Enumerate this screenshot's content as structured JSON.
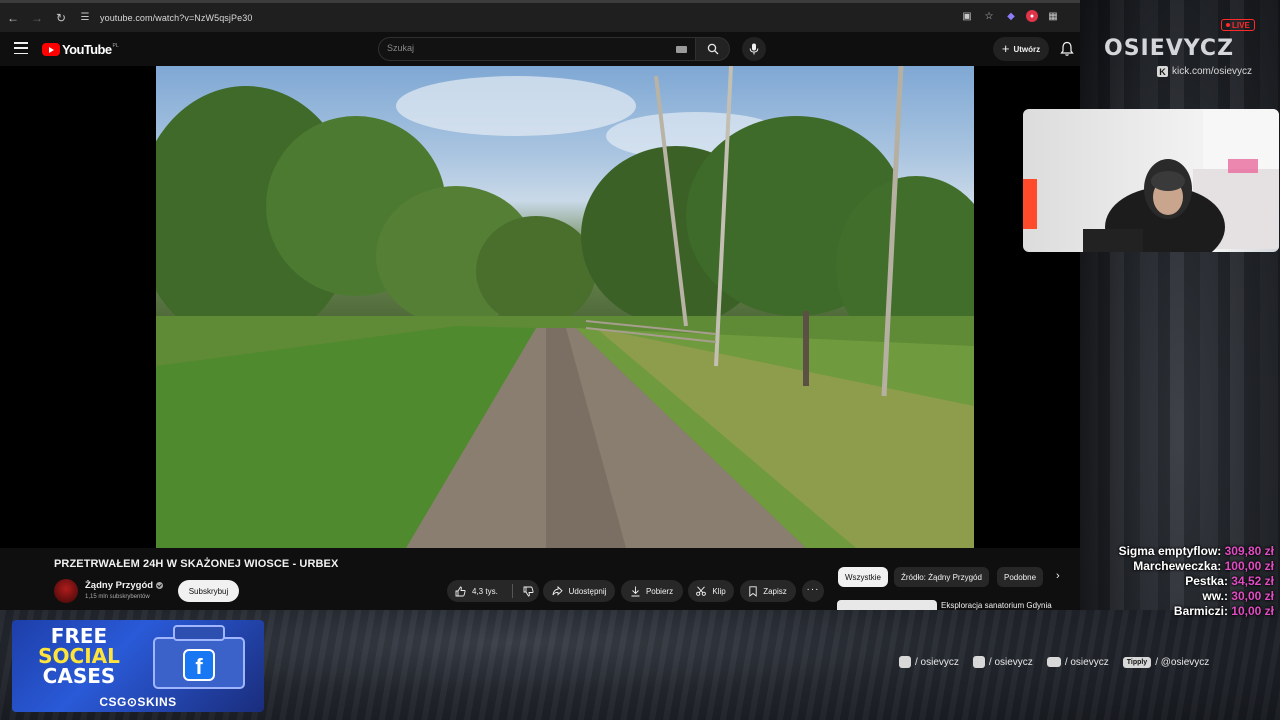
{
  "browser": {
    "url": "youtube.com/watch?v=NzW5qsjPe30"
  },
  "youtube": {
    "logo_text": "YouTube",
    "region": "PL",
    "search_placeholder": "Szukaj",
    "create_label": "Utwórz"
  },
  "video": {
    "title": "PRZETRWAŁEM 24H W SKAŻONEJ WIOSCE - URBEX",
    "channel": "Żądny Przygód",
    "subscribers": "1,15 mln subskrybentów",
    "subscribe_label": "Subskrybuj",
    "likes": "4,3 tys.",
    "share_label": "Udostępnij",
    "download_label": "Pobierz",
    "clip_label": "Klip",
    "save_label": "Zapisz"
  },
  "related": {
    "chips": [
      "Wszystkie",
      "Źródło: Żądny Przygód",
      "Podobne"
    ],
    "first_title": "Eksploracja sanatorium Gdynia"
  },
  "stream": {
    "live_label": "LIVE",
    "brand": "OSIEVYCZ",
    "kick": "kick.com/osievycz",
    "donations": [
      {
        "name": "Sigma emptyflow:",
        "amount": "309,80 zł"
      },
      {
        "name": "Marcheweczka:",
        "amount": "100,00 zł"
      },
      {
        "name": "Pestka:",
        "amount": "34,52 zł"
      },
      {
        "name": "ww.:",
        "amount": "30,00 zł"
      },
      {
        "name": "Barmiczi:",
        "amount": "10,00 zł"
      }
    ],
    "socials": [
      {
        "icon": "instagram-icon",
        "label": "/ osievycz"
      },
      {
        "icon": "tiktok-icon",
        "label": "/ osievycz"
      },
      {
        "icon": "youtube-icon",
        "label": "/ osievycz"
      },
      {
        "icon": "tipply-badge",
        "badge": "Tipply",
        "label": "/ @osievycz"
      }
    ]
  },
  "promo": {
    "line1": "FREE",
    "line2": "SOCIAL",
    "line3": "CASES",
    "logo": "CSG⊙SKINS"
  }
}
